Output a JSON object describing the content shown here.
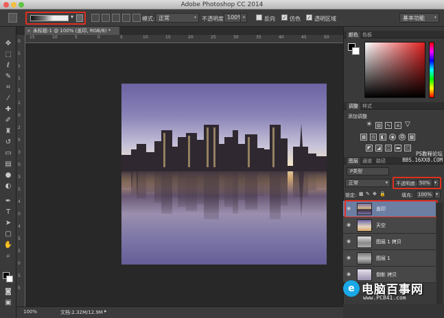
{
  "app": {
    "title": "Adobe Photoshop CC 2014"
  },
  "options_bar": {
    "mode_label": "模式:",
    "mode_value": "正常",
    "opacity_label": "不透明度:",
    "opacity_value": "100%",
    "reverse_label": "反向",
    "dither_label": "仿色",
    "transparency_label": "透明区域",
    "workspace_value": "基本功能"
  },
  "document": {
    "tab_label": "未标题-1 @ 100% (盖印, RGB/8) *",
    "zoom": "100%",
    "doc_size": "文档:2.32M/12.9M"
  },
  "ruler": {
    "h_ticks": [
      "15",
      "10",
      "5",
      "0",
      "5",
      "10",
      "15",
      "20",
      "25",
      "30",
      "35",
      "40",
      "45",
      "50"
    ],
    "v_ticks": [
      "0",
      "5",
      "1",
      "1",
      "5",
      "2",
      "0",
      "2",
      "5",
      "3",
      "0",
      "3",
      "5",
      "4",
      "0",
      "4",
      "5",
      "5",
      "0",
      "5",
      "5"
    ]
  },
  "color_panel": {
    "tab_color": "颜色",
    "tab_swatches": "色板"
  },
  "adjustments_panel": {
    "tab_adjust": "调整",
    "tab_style": "样式",
    "title": "添加调整"
  },
  "layers_panel": {
    "tab_layers": "图层",
    "tab_channels": "通道",
    "tab_paths": "路径",
    "kind_filter": "P类型",
    "blend_mode": "正常",
    "opacity_label": "不透明度:",
    "opacity_value": "50%",
    "lock_label": "锁定:",
    "fill_label": "填充:",
    "fill_value": "100%",
    "layers": [
      {
        "name": "盖印",
        "selected": true
      },
      {
        "name": "天空",
        "selected": false
      },
      {
        "name": "图层 1 拷贝",
        "selected": false
      },
      {
        "name": "图层 1",
        "selected": false
      },
      {
        "name": "倒影 拷贝",
        "selected": false
      }
    ]
  },
  "watermark": {
    "line1": "PS教程论坛",
    "line2": "BBS.16XX8.COM"
  },
  "logo": {
    "badge": "e",
    "name": "电脑百事网",
    "url": "www.PC841.com"
  },
  "colors": {
    "highlight": "#e02f20",
    "selected_layer": "#6d7ea3",
    "panel_bg": "#3a3a3a"
  }
}
